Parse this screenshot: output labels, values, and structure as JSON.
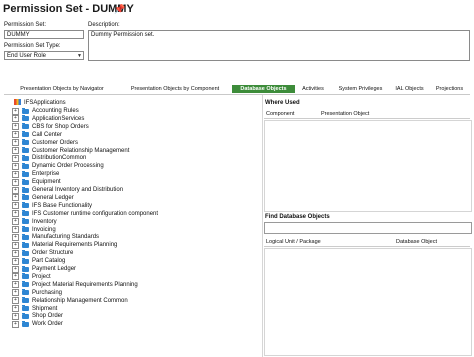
{
  "header": {
    "title": "Permission Set - DUMMY"
  },
  "form": {
    "permission_set_label": "Permission Set:",
    "permission_set_value": "DUMMY",
    "description_label": "Description:",
    "description_value": "Dummy Permission set.",
    "type_label": "Permission Set Type:",
    "type_value": "End User Role"
  },
  "tabs": [
    {
      "label": "Presentation Objects by Navigator",
      "active": false
    },
    {
      "label": "Presentation Objects by Component",
      "active": false
    },
    {
      "label": "Database Objects",
      "active": true
    },
    {
      "label": "Activities",
      "active": false
    },
    {
      "label": "System Privileges",
      "active": false
    },
    {
      "label": "IAL Objects",
      "active": false
    },
    {
      "label": "Projections",
      "active": false
    }
  ],
  "tree": {
    "root": "IFSApplications",
    "items": [
      "Accounting Rules",
      "ApplicationServices",
      "CBS for Shop Orders",
      "Call Center",
      "Customer Orders",
      "Customer Relationship Management",
      "DistributionCommon",
      "Dynamic Order Processing",
      "Enterprise",
      "Equipment",
      "General Inventory and Distribution",
      "General Ledger",
      "IFS Base Functionality",
      "IFS Customer runtime configuration component",
      "Inventory",
      "Invoicing",
      "Manufacturing Standards",
      "Material Requirements Planning",
      "Order Structure",
      "Part Catalog",
      "Payment Ledger",
      "Project",
      "Project Material Requirements Planning",
      "Purchasing",
      "Relationship Management Common",
      "Shipment",
      "Shop Order",
      "Work Order"
    ]
  },
  "where_used": {
    "title": "Where Used",
    "col_component": "Component",
    "col_presentation": "Presentation Object"
  },
  "find_db": {
    "title": "Find Database Objects",
    "col_logical": "Logical Unit / Package",
    "col_db": "Database Object"
  }
}
